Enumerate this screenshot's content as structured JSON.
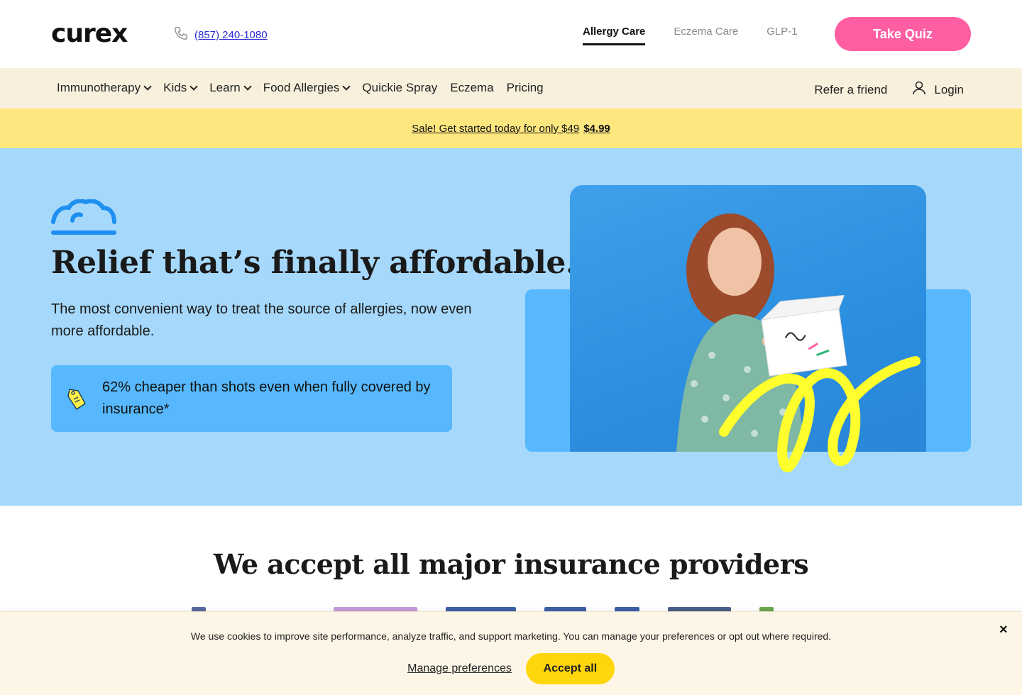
{
  "header": {
    "logo": "curex",
    "phone": "(857) 240-1080",
    "tabs": [
      {
        "label": "Allergy Care",
        "active": true
      },
      {
        "label": "Eczema Care",
        "active": false
      },
      {
        "label": "GLP-1",
        "active": false
      }
    ],
    "cta": "Take Quiz",
    "cta_color": "#ff5fa2"
  },
  "nav": {
    "items": [
      {
        "label": "Immunotherapy",
        "dropdown": true
      },
      {
        "label": "Kids",
        "dropdown": true
      },
      {
        "label": "Learn",
        "dropdown": true
      },
      {
        "label": "Food Allergies",
        "dropdown": true
      },
      {
        "label": "Quickie Spray",
        "dropdown": false
      },
      {
        "label": "Eczema",
        "dropdown": false
      },
      {
        "label": "Pricing",
        "dropdown": false
      }
    ],
    "refer": "Refer a friend",
    "login": "Login"
  },
  "promo": {
    "text": "Sale! Get started today for only $49",
    "price": "$4.99"
  },
  "hero": {
    "title": "Relief that’s finally affordable.",
    "subtitle": "The most convenient way to treat the source of allergies, now even more affordable.",
    "savings": "62% cheaper than shots even when fully covered by insurance*",
    "colors": {
      "bg": "#a5d8fb",
      "card": "#57b8fd",
      "accent": "#ffff2e"
    }
  },
  "insurance": {
    "title": "We accept all major insurance providers"
  },
  "cookie": {
    "text": "We use cookies to improve site performance, analyze traffic, and support marketing. You can manage your preferences or opt out where required.",
    "manage": "Manage preferences",
    "accept": "Accept all",
    "close": "×"
  }
}
